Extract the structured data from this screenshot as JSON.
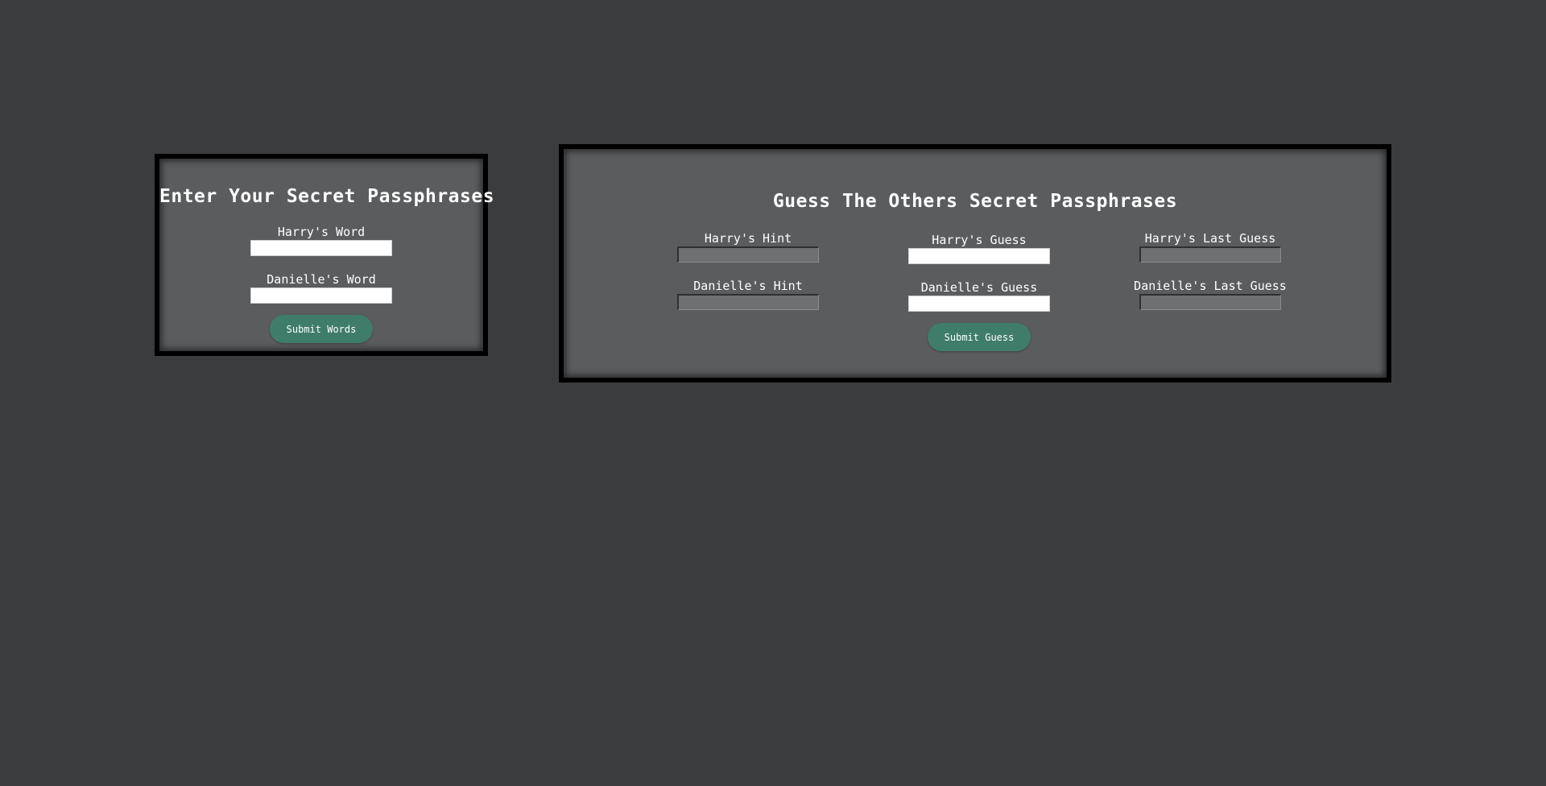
{
  "enter_panel": {
    "title": "Enter Your Secret Passphrases",
    "harry_word_label": "Harry's Word",
    "harry_word_value": "",
    "danielle_word_label": "Danielle's Word",
    "danielle_word_value": "",
    "submit_label": "Submit Words"
  },
  "guess_panel": {
    "title": "Guess The Others Secret Passphrases",
    "harry_hint_label": "Harry's Hint",
    "harry_hint_value": "",
    "danielle_hint_label": "Danielle's Hint",
    "danielle_hint_value": "",
    "harry_guess_label": "Harry's Guess",
    "harry_guess_value": "",
    "danielle_guess_label": "Danielle's Guess",
    "danielle_guess_value": "",
    "harry_last_guess_label": "Harry's Last Guess",
    "harry_last_guess_value": "",
    "danielle_last_guess_label": "Danielle's Last Guess",
    "danielle_last_guess_value": "",
    "submit_label": "Submit Guess"
  },
  "colors": {
    "page_background": "#3b3c3e",
    "panel_background": "#5b5c5e",
    "panel_border": "#000000",
    "button": "#3f7d6a",
    "readonly_field": "#6f7072"
  }
}
